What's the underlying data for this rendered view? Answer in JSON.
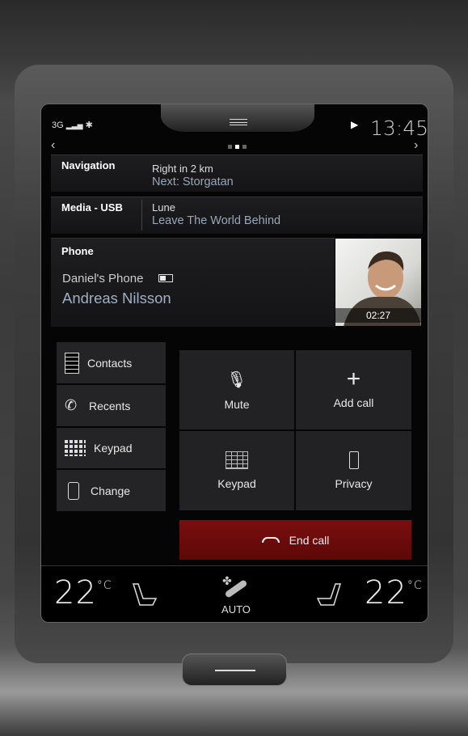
{
  "status": {
    "network": "3G",
    "clock": "13:45"
  },
  "pager": {
    "pages": 3,
    "active": 2
  },
  "navigation": {
    "label": "Navigation",
    "line1": "Right in 2 km",
    "line2": "Next: Storgatan"
  },
  "media": {
    "label": "Media - USB",
    "line1": "Lune",
    "line2": "Leave The World Behind"
  },
  "phone": {
    "label": "Phone",
    "device": "Daniel's Phone",
    "caller": "Andreas Nilsson",
    "duration": "02:27"
  },
  "phone_menu": [
    {
      "label": "Contacts",
      "icon": "contacts-icon"
    },
    {
      "label": "Recents",
      "icon": "recents-icon"
    },
    {
      "label": "Keypad",
      "icon": "keypad-icon"
    },
    {
      "label": "Change",
      "icon": "change-phone-icon"
    }
  ],
  "call_controls": {
    "mute": "Mute",
    "add_call": "Add call",
    "keypad": "Keypad",
    "privacy": "Privacy",
    "end_call": "End call"
  },
  "climate": {
    "left_temp": "22",
    "right_temp": "22",
    "unit": "°C",
    "mode": "AUTO"
  },
  "colors": {
    "end_call": "#6e0a0a",
    "secondary_text": "#9aa7b8"
  }
}
